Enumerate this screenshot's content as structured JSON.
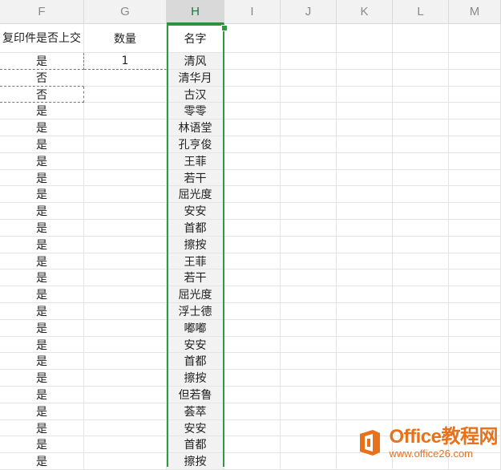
{
  "columns": [
    "F",
    "G",
    "H",
    "I",
    "J",
    "K",
    "L",
    "M"
  ],
  "headers": {
    "F": "复印件是否上交",
    "G": "数量",
    "H": "名字"
  },
  "rows": [
    {
      "f": "是",
      "g": "1",
      "h": "清风"
    },
    {
      "f": "否",
      "g": "",
      "h": "清华月"
    },
    {
      "f": "否",
      "g": "",
      "h": "古汉"
    },
    {
      "f": "是",
      "g": "",
      "h": "零零"
    },
    {
      "f": "是",
      "g": "",
      "h": "林语堂"
    },
    {
      "f": "是",
      "g": "",
      "h": "孔亨俊"
    },
    {
      "f": "是",
      "g": "",
      "h": "王菲"
    },
    {
      "f": "是",
      "g": "",
      "h": "若干"
    },
    {
      "f": "是",
      "g": "",
      "h": "屈光度"
    },
    {
      "f": "是",
      "g": "",
      "h": "安安"
    },
    {
      "f": "是",
      "g": "",
      "h": "首都"
    },
    {
      "f": "是",
      "g": "",
      "h": "擦按"
    },
    {
      "f": "是",
      "g": "",
      "h": "王菲"
    },
    {
      "f": "是",
      "g": "",
      "h": "若干"
    },
    {
      "f": "是",
      "g": "",
      "h": "屈光度"
    },
    {
      "f": "是",
      "g": "",
      "h": "浮士德"
    },
    {
      "f": "是",
      "g": "",
      "h": "嘟嘟"
    },
    {
      "f": "是",
      "g": "",
      "h": "安安"
    },
    {
      "f": "是",
      "g": "",
      "h": "首都"
    },
    {
      "f": "是",
      "g": "",
      "h": "擦按"
    },
    {
      "f": "是",
      "g": "",
      "h": "但若鲁"
    },
    {
      "f": "是",
      "g": "",
      "h": "荟萃"
    },
    {
      "f": "是",
      "g": "",
      "h": "安安"
    },
    {
      "f": "是",
      "g": "",
      "h": "首都"
    },
    {
      "f": "是",
      "g": "",
      "h": "擦按"
    }
  ],
  "watermark": {
    "main": "Office教程网",
    "url": "www.office26.com",
    "accent": "#e8721c"
  },
  "selection_color": "#2e9a3f"
}
